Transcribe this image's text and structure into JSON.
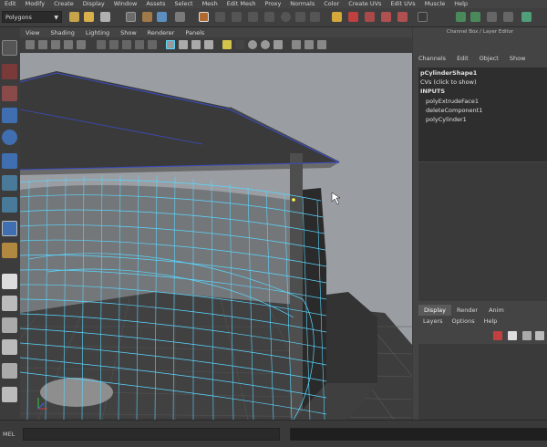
{
  "menubar": {
    "items": [
      "Edit",
      "Modify",
      "Create",
      "Display",
      "Window",
      "Assets",
      "Select",
      "Mesh",
      "Edit Mesh",
      "Proxy",
      "Normals",
      "Color",
      "Create UVs",
      "Edit UVs",
      "Muscle",
      "Help"
    ]
  },
  "status_line": {
    "mode_selected": "Polygons"
  },
  "panel_menu": {
    "items": [
      "View",
      "Shading",
      "Lighting",
      "Show",
      "Renderer",
      "Panels"
    ]
  },
  "channel_box": {
    "title": "Channel Box / Layer Editor",
    "menu": [
      "Channels",
      "Edit",
      "Object",
      "Show"
    ],
    "shape_name": "pCylinderShape1",
    "cvs_label": "CVs (click to show)",
    "inputs_label": "INPUTS",
    "inputs": [
      "polyExtrudeFace1",
      "deleteComponent1",
      "polyCylinder1"
    ]
  },
  "layer_editor": {
    "tabs": [
      "Display",
      "Render",
      "Anim"
    ],
    "active_tab": "Display",
    "menu": [
      "Layers",
      "Options",
      "Help"
    ]
  },
  "command_line": {
    "language_label": "MEL"
  },
  "colors": {
    "wireframe": "#5ad7ff",
    "highlight": "#ffffff",
    "viewport_bg": "#9a9ea3"
  },
  "toolbox": {
    "tools": [
      "select-tool",
      "lasso-tool",
      "paint-select-tool",
      "move-tool",
      "rotate-tool",
      "scale-tool",
      "universal-manipulator",
      "soft-mod-tool",
      "show-manipulator",
      "last-tool",
      "layout-single",
      "layout-four",
      "layout-two",
      "layout-outliner",
      "layout-graph",
      "layout-hypershade"
    ]
  }
}
